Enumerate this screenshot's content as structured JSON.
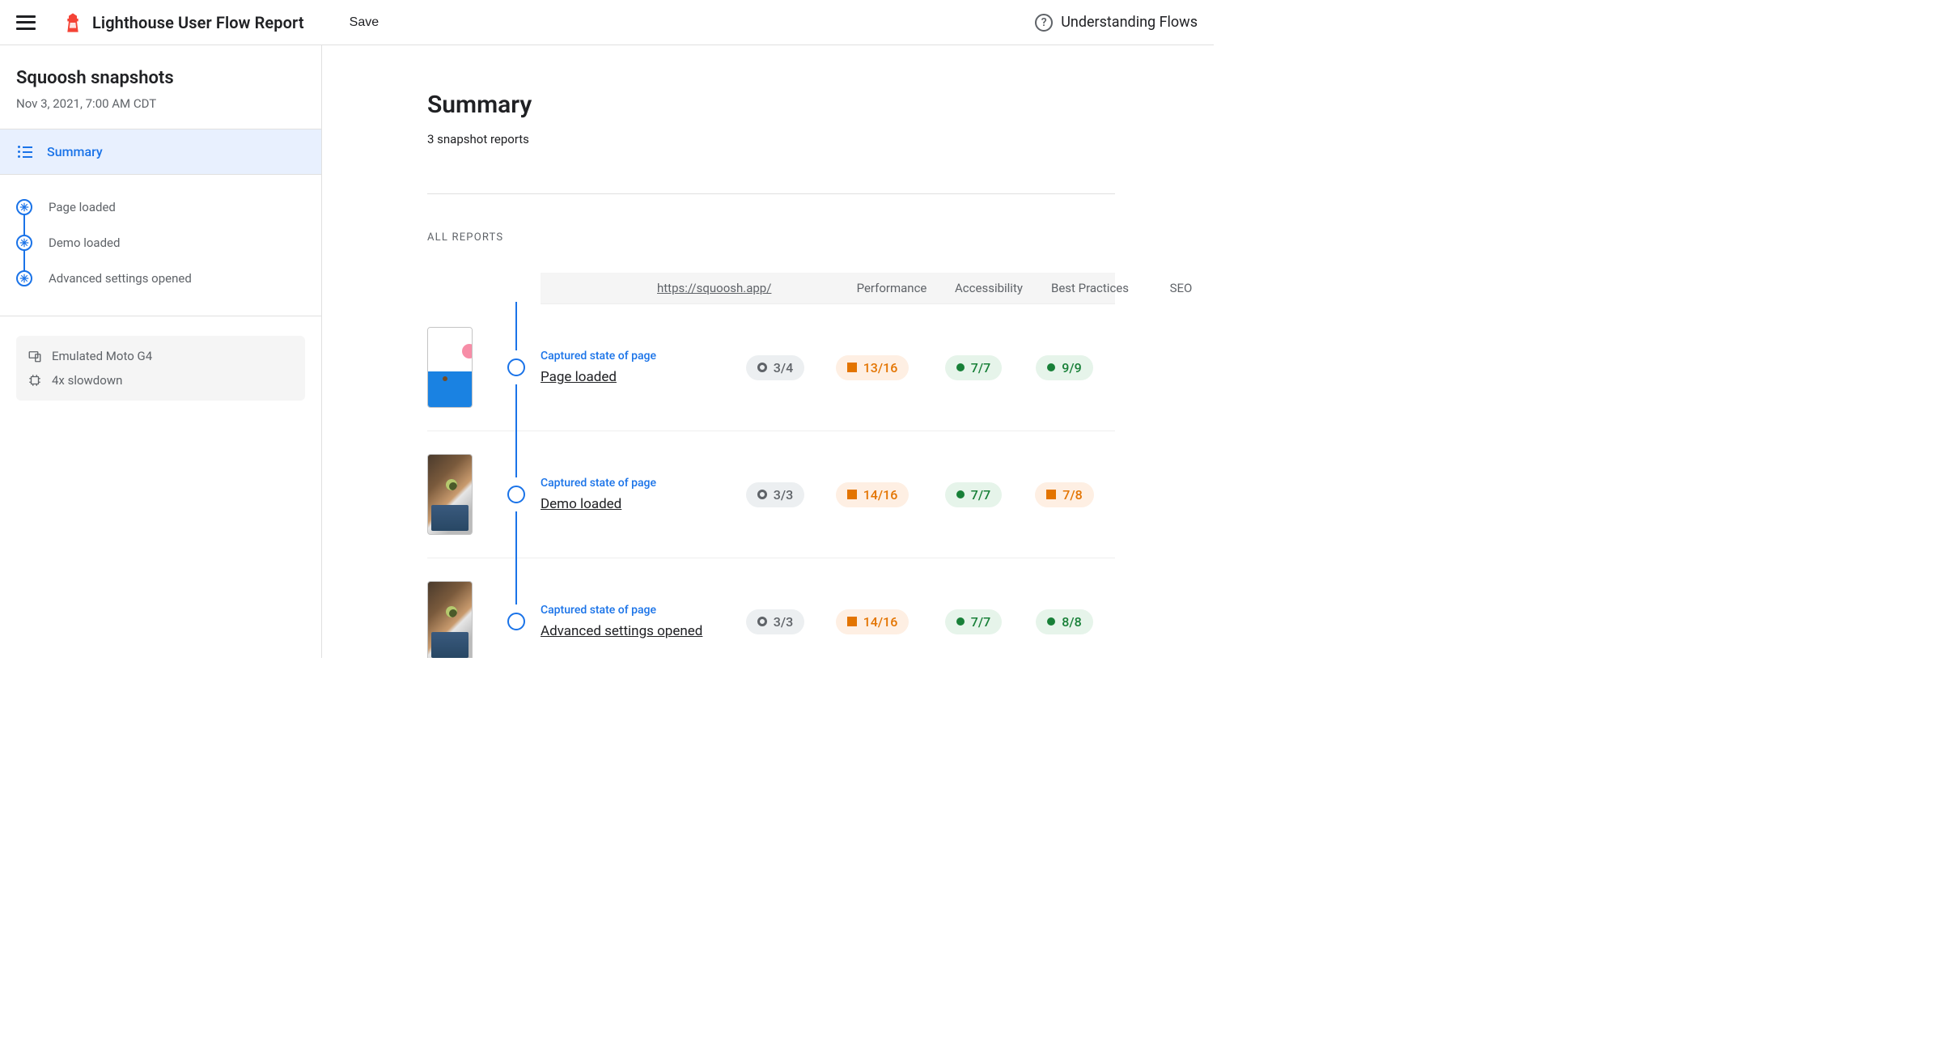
{
  "header": {
    "app_title": "Lighthouse User Flow Report",
    "save_label": "Save",
    "help_label": "Understanding Flows"
  },
  "sidebar": {
    "report_name": "Squoosh snapshots",
    "report_date": "Nov 3, 2021, 7:00 AM CDT",
    "summary_label": "Summary",
    "steps": [
      {
        "label": "Page loaded"
      },
      {
        "label": "Demo loaded"
      },
      {
        "label": "Advanced settings opened"
      }
    ],
    "meta": {
      "device": "Emulated Moto G4",
      "throttle": "4x slowdown"
    }
  },
  "main": {
    "title": "Summary",
    "subtitle": "3 snapshot reports",
    "all_reports_label": "ALL REPORTS",
    "url": "https://squoosh.app/",
    "columns": {
      "performance": "Performance",
      "accessibility": "Accessibility",
      "best_practices": "Best Practices",
      "seo": "SEO"
    },
    "captured_label": "Captured state of page",
    "rows": [
      {
        "name": "Page loaded",
        "thumb": "blank",
        "performance": {
          "text": "3/4",
          "tone": "gray"
        },
        "accessibility": {
          "text": "13/16",
          "tone": "orange"
        },
        "best_practices": {
          "text": "7/7",
          "tone": "green"
        },
        "seo": {
          "text": "9/9",
          "tone": "green"
        }
      },
      {
        "name": "Demo loaded",
        "thumb": "cat",
        "performance": {
          "text": "3/3",
          "tone": "gray"
        },
        "accessibility": {
          "text": "14/16",
          "tone": "orange"
        },
        "best_practices": {
          "text": "7/7",
          "tone": "green"
        },
        "seo": {
          "text": "7/8",
          "tone": "orange"
        }
      },
      {
        "name": "Advanced settings opened",
        "thumb": "cat",
        "performance": {
          "text": "3/3",
          "tone": "gray"
        },
        "accessibility": {
          "text": "14/16",
          "tone": "orange"
        },
        "best_practices": {
          "text": "7/7",
          "tone": "green"
        },
        "seo": {
          "text": "8/8",
          "tone": "green"
        }
      }
    ]
  }
}
